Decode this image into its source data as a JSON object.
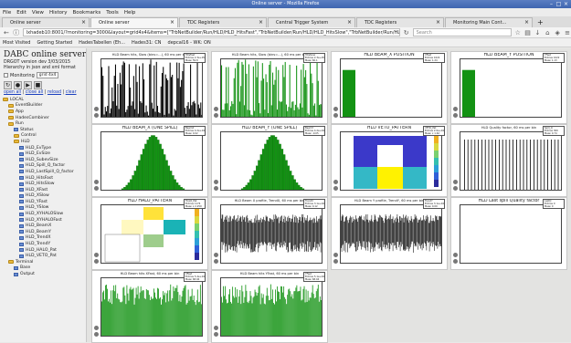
{
  "window": {
    "title": "Online server - Mozilla Firefox",
    "controls": [
      "–",
      "□",
      "×"
    ]
  },
  "menu": [
    "File",
    "Edit",
    "View",
    "History",
    "Bookmarks",
    "Tools",
    "Help"
  ],
  "tabs": [
    {
      "label": "Online server",
      "active": false
    },
    {
      "label": "Online server",
      "active": true
    },
    {
      "label": "TDC Registers",
      "active": false
    },
    {
      "label": "Central Trigger System",
      "active": false
    },
    {
      "label": "TDC Registers",
      "active": false
    },
    {
      "label": "Monitoring Main Cont...",
      "active": false
    }
  ],
  "new_tab_label": "+",
  "url": "lxhadeb10:8001/?monitoring=3000&layout=grid4x4&items=[\"TrbNetBuilder/Run/HLD/HLD_HitsFast\",\"TrbNetBuilder/Run/HLD/HLD_HitsSlow\",\"TrbNetBuilder/Run/HLD/HLD_TrendF\"]&sel",
  "search_placeholder": "Search",
  "bookmarks": [
    "Most Visited",
    "Getting Started",
    "HadesTabellen (Eh...",
    "Hades31: CN",
    "depcal16 - WK: ON"
  ],
  "sidebar": {
    "title": "DABC online server",
    "version_line": "DRGOT version dev 3/03/2015",
    "hierarchy_line": "Hierarchy in json and xml format",
    "monitoring_label": "Monitoring",
    "layout_value": "grid 4x4",
    "links": [
      "open all",
      "close all",
      "reload",
      "clear"
    ],
    "tree": [
      {
        "depth": 0,
        "label": "LOCAL",
        "kind": "folder"
      },
      {
        "depth": 1,
        "label": "EventBuilder",
        "kind": "folder"
      },
      {
        "depth": 1,
        "label": "App",
        "kind": "folder"
      },
      {
        "depth": 1,
        "label": "HadesCombiner",
        "kind": "folder"
      },
      {
        "depth": 1,
        "label": "Run",
        "kind": "folder"
      },
      {
        "depth": 2,
        "label": "Status",
        "kind": "leaf"
      },
      {
        "depth": 2,
        "label": "Control",
        "kind": "folder"
      },
      {
        "depth": 2,
        "label": "HLD",
        "kind": "folder"
      },
      {
        "depth": 3,
        "label": "HLD_EvType",
        "kind": "leaf"
      },
      {
        "depth": 3,
        "label": "HLD_EvSize",
        "kind": "leaf"
      },
      {
        "depth": 3,
        "label": "HLD_SubevSize",
        "kind": "leaf"
      },
      {
        "depth": 3,
        "label": "HLD_Spill_Q_factor",
        "kind": "leaf"
      },
      {
        "depth": 3,
        "label": "HLD_LastSpill_Q_factor",
        "kind": "leaf"
      },
      {
        "depth": 3,
        "label": "HLD_HitsFast",
        "kind": "leaf"
      },
      {
        "depth": 3,
        "label": "HLD_HitsSlow",
        "kind": "leaf"
      },
      {
        "depth": 3,
        "label": "HLD_XFast",
        "kind": "leaf"
      },
      {
        "depth": 3,
        "label": "HLD_XSlow",
        "kind": "leaf"
      },
      {
        "depth": 3,
        "label": "HLD_YFast",
        "kind": "leaf"
      },
      {
        "depth": 3,
        "label": "HLD_YSlow",
        "kind": "leaf"
      },
      {
        "depth": 3,
        "label": "HLD_XYHALOSlow",
        "kind": "leaf"
      },
      {
        "depth": 3,
        "label": "HLD_XYHALOFast",
        "kind": "leaf"
      },
      {
        "depth": 3,
        "label": "HLD_BeamX",
        "kind": "leaf"
      },
      {
        "depth": 3,
        "label": "HLD_BeamY",
        "kind": "leaf"
      },
      {
        "depth": 3,
        "label": "HLD_TrendX",
        "kind": "leaf"
      },
      {
        "depth": 3,
        "label": "HLD_TrendY",
        "kind": "leaf"
      },
      {
        "depth": 3,
        "label": "HLD_HALO_Pat",
        "kind": "leaf"
      },
      {
        "depth": 3,
        "label": "HLD_VETO_Pat",
        "kind": "leaf"
      },
      {
        "depth": 1,
        "label": "Terminal",
        "kind": "folder"
      },
      {
        "depth": 2,
        "label": "Base",
        "kind": "leaf"
      },
      {
        "depth": 2,
        "label": "Output",
        "kind": "leaf"
      }
    ]
  },
  "panels": [
    {
      "title": "HLD Beam hits, Slow (bins=...), 60 ms per bin",
      "type": "spikes-black",
      "big": false,
      "stats": "HitsFast\nEntries 2.3e+05\nMean 59.8"
    },
    {
      "title": "HLD Beam hits, Slow (bins=...), 60 ms per bin",
      "type": "spikes-green",
      "big": false,
      "stats": "HitsSlow\nEntries 2.3e+05\nMean 60.1"
    },
    {
      "title": "HLD BEAM_X POSITION",
      "type": "step-green",
      "big": true,
      "stats": "XFast\nEntries 1022\nMean 1.24"
    },
    {
      "title": "HLD BEAM_Y POSITION",
      "type": "step-green",
      "big": true,
      "stats": "YFast\nEntries 1022\nMean 1.13"
    },
    {
      "title": "HLD BEAM_X (ONE SPILL)",
      "type": "gauss-green",
      "big": true,
      "stats": "BeamX\nEntries 4.2e+04\nMean 0.02"
    },
    {
      "title": "HLD BEAM_Y (ONE SPILL)",
      "type": "gauss-green",
      "big": true,
      "stats": "BeamY\nEntries 4.2e+04\nMean -0.05"
    },
    {
      "title": "HLD VETO_PATTERN",
      "type": "heat-veto",
      "big": true,
      "stats": "VETO_Pat\nEntries 2.0e+04\nMean x 1.62"
    },
    {
      "title": "HLD Quality factor, 60 ms per bin",
      "type": "lines-black",
      "big": false,
      "stats": "Spill_Q\nEntries 300\nMean 0.74"
    },
    {
      "title": "HLD HALO_PATTERN",
      "type": "heat-halo",
      "big": true,
      "stats": "HALO_Pat\nEntries 1174\nMean x 2.259"
    },
    {
      "title": "HLD Beam X profile, TrendX, 60 ms per bin",
      "type": "band-black",
      "big": false,
      "stats": "TrendX\nEntries 3.1e+04\nMean 0.12"
    },
    {
      "title": "HLD Beam Y profile, TrendY, 60 ms per bin",
      "type": "band-black",
      "big": false,
      "stats": "TrendY\nEntries 3.1e+04\nMean 0.09"
    },
    {
      "title": "HLD Last spill Quality factor",
      "type": "empty",
      "big": true,
      "stats": "LastQ\nEntries 0\nMean 0"
    },
    {
      "title": "HLD Beam hits XFast, 60 ms per bin",
      "type": "spikes-green-dense",
      "big": false,
      "stats": "XFast\nEntries 5.4e+04\nMean 68.94"
    },
    {
      "title": "HLD Beam hits YFast, 60 ms per bin",
      "type": "spikes-green-dense",
      "big": false,
      "stats": "YFast\nEntries 5.1e+04\nMean 68.04"
    }
  ],
  "colors": {
    "histogram_fill": "#139213",
    "histogram_line": "#000000",
    "veto_top": "#3b39c9",
    "veto_yellow": "#fff200",
    "veto_teal": "#34b8c6",
    "halo_yellow": "#ffe23a",
    "halo_teal": "#1ab3b6",
    "halo_olive": "#9ecd8c"
  }
}
